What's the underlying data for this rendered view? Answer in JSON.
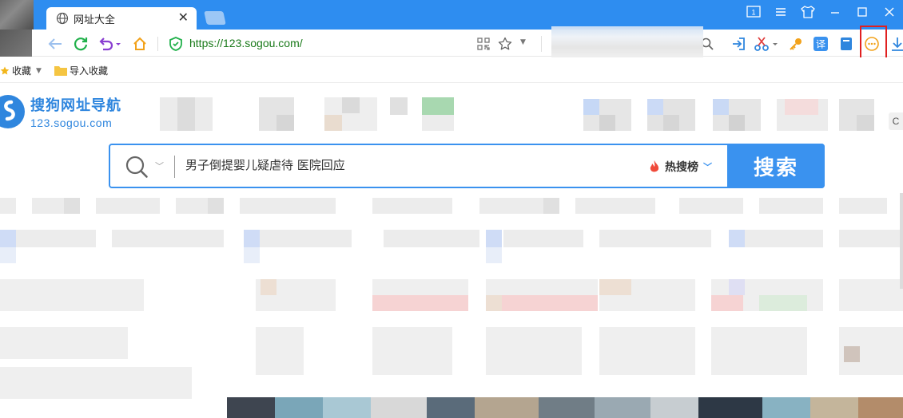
{
  "tab": {
    "title": "网址大全"
  },
  "toolbar": {
    "url": "https://123.sogou.com/"
  },
  "bookmarks": {
    "items": [
      {
        "label": "收藏"
      },
      {
        "label": "导入收藏"
      }
    ]
  },
  "logo": {
    "name": "搜狗网址导航",
    "domain": "123.sogou.com"
  },
  "search": {
    "query": "男子倒提婴儿疑虐待 医院回应",
    "hot_label": "热搜榜",
    "button_label": "搜索"
  },
  "side_tab": {
    "label": "C"
  },
  "colors": {
    "titlebar": "#2e8df0",
    "accent": "#3a92ef",
    "url_secure": "#1a7a1a",
    "alert_box": "#e02020"
  }
}
